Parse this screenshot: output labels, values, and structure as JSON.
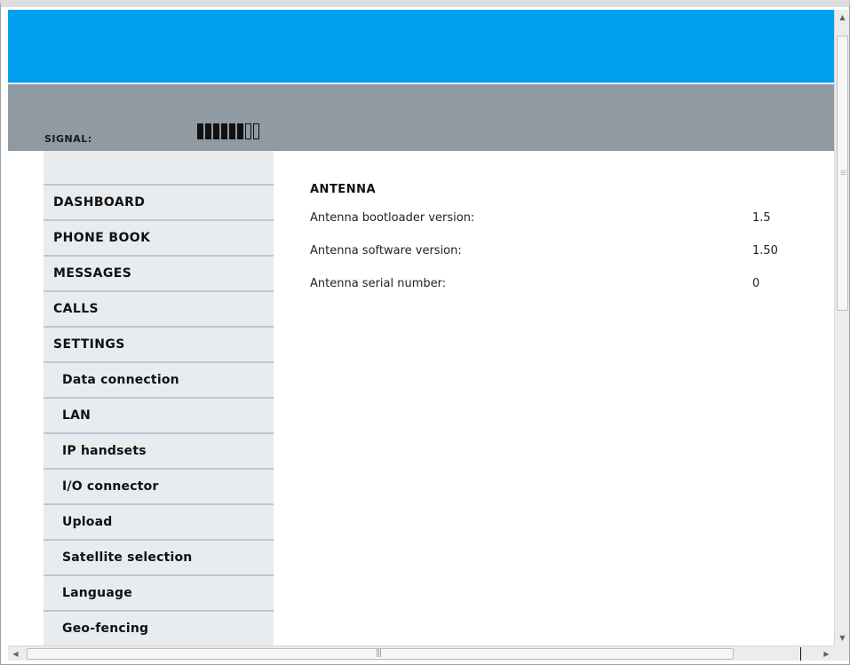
{
  "header": {
    "signal_label": "SIGNAL:",
    "signal_strength": 6,
    "signal_max": 8
  },
  "sidebar": {
    "items": [
      {
        "label": "DASHBOARD",
        "sub": false
      },
      {
        "label": "PHONE BOOK",
        "sub": false
      },
      {
        "label": "MESSAGES",
        "sub": false
      },
      {
        "label": "CALLS",
        "sub": false
      },
      {
        "label": "SETTINGS",
        "sub": false
      },
      {
        "label": "Data connection",
        "sub": true
      },
      {
        "label": "LAN",
        "sub": true
      },
      {
        "label": "IP handsets",
        "sub": true
      },
      {
        "label": "I/O connector",
        "sub": true
      },
      {
        "label": "Upload",
        "sub": true
      },
      {
        "label": "Satellite selection",
        "sub": true
      },
      {
        "label": "Language",
        "sub": true
      },
      {
        "label": "Geo-fencing",
        "sub": true
      }
    ]
  },
  "main": {
    "section_title": "ANTENNA",
    "rows": [
      {
        "label": "Antenna bootloader version:",
        "value": "1.5"
      },
      {
        "label": "Antenna software version:",
        "value": "1.50"
      },
      {
        "label": "Antenna serial number:",
        "value": "0"
      }
    ]
  },
  "colors": {
    "top_band": "#00a0ee",
    "status_band": "#8f9aa3",
    "sidebar_bg": "#e9ecef",
    "sidebar_divider": "#b9c7d6"
  },
  "scrollbars": {
    "up_icon": "arrow-up-icon",
    "down_icon": "arrow-down-icon",
    "left_icon": "arrow-left-icon",
    "right_icon": "arrow-right-icon"
  }
}
